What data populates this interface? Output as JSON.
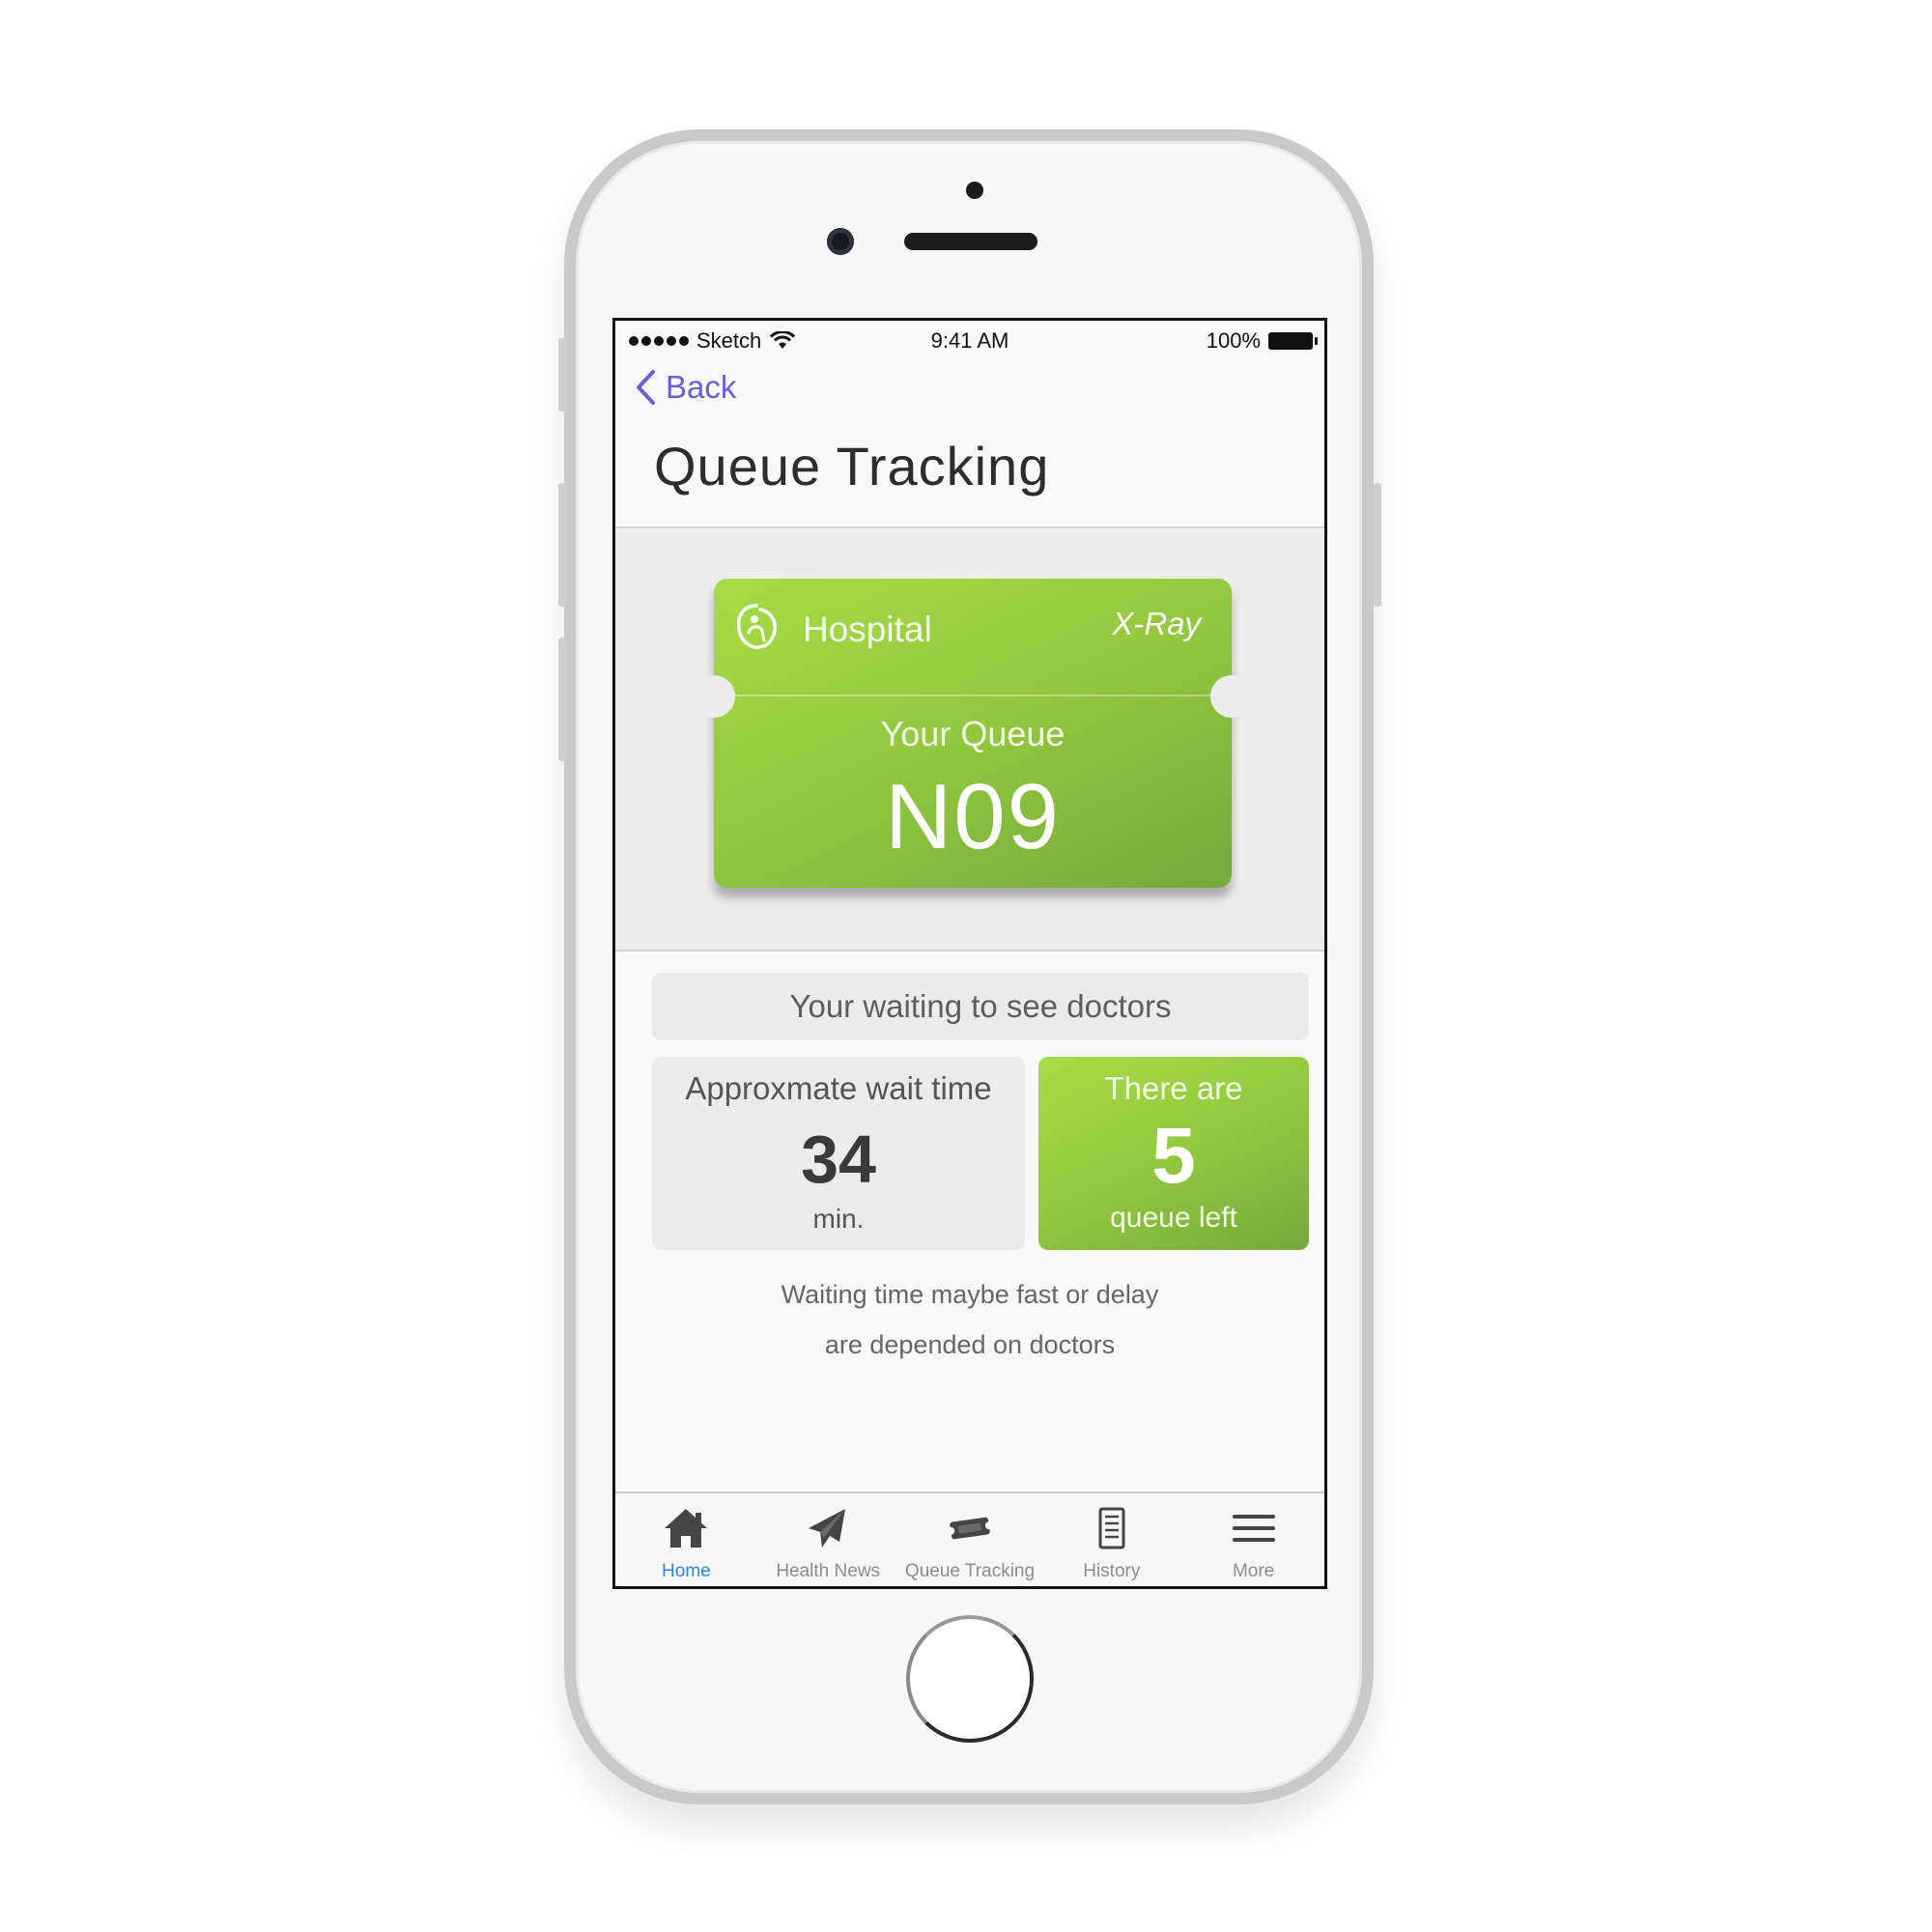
{
  "status_bar": {
    "carrier": "Sketch",
    "time": "9:41 AM",
    "battery": "100%"
  },
  "nav": {
    "back_label": "Back"
  },
  "page": {
    "title": "Queue Tracking"
  },
  "ticket": {
    "hospital": "Hospital",
    "department": "X-Ray",
    "queue_label": "Your Queue",
    "queue_number": "N09"
  },
  "status": {
    "banner": "Your waiting to see doctors",
    "wait_label": "Approxmate wait time",
    "wait_value": "34",
    "wait_unit": "min.",
    "left_label": "There are",
    "left_value": "5",
    "left_unit": "queue left",
    "note_line1": "Waiting time maybe fast or delay",
    "note_line2": "are depended on doctors"
  },
  "tabs": [
    {
      "label": "Home",
      "icon": "home-icon",
      "active": true
    },
    {
      "label": "Health News",
      "icon": "paper-plane-icon",
      "active": false
    },
    {
      "label": "Queue Tracking",
      "icon": "ticket-icon",
      "active": false
    },
    {
      "label": "History",
      "icon": "document-icon",
      "active": false
    },
    {
      "label": "More",
      "icon": "menu-icon",
      "active": false
    }
  ],
  "colors": {
    "accent_green": "#93c840",
    "back_link": "#6a5fd6",
    "active_tab": "#2f86e8"
  }
}
